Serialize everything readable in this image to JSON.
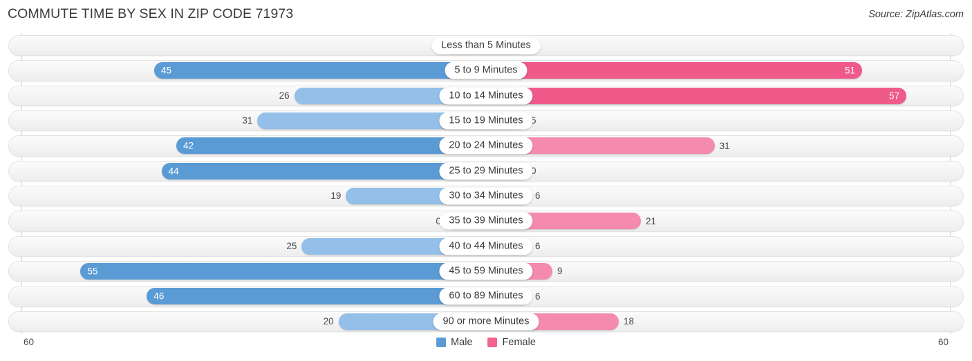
{
  "header": {
    "title": "COMMUTE TIME BY SEX IN ZIP CODE 71973",
    "source": "Source: ZipAtlas.com"
  },
  "legend": {
    "male_label": "Male",
    "female_label": "Female",
    "male_color": "#5b9bd5",
    "female_color": "#f2648f"
  },
  "axis": {
    "left_tick": "60",
    "right_tick": "60",
    "max": 60
  },
  "chart_data": {
    "type": "bar",
    "title": "COMMUTE TIME BY SEX IN ZIP CODE 71973",
    "subtitle": "Source: ZipAtlas.com",
    "orientation": "horizontal-diverging",
    "xlabel": "",
    "ylabel": "",
    "xlim": [
      60,
      60
    ],
    "grid": false,
    "legend_position": "bottom-center",
    "categories": [
      "Less than 5 Minutes",
      "5 to 9 Minutes",
      "10 to 14 Minutes",
      "15 to 19 Minutes",
      "20 to 24 Minutes",
      "25 to 29 Minutes",
      "30 to 34 Minutes",
      "35 to 39 Minutes",
      "40 to 44 Minutes",
      "45 to 59 Minutes",
      "60 to 89 Minutes",
      "90 or more Minutes"
    ],
    "series": [
      {
        "name": "Male",
        "color": "#5b9bd5",
        "values": [
          0,
          45,
          26,
          31,
          42,
          44,
          19,
          0,
          25,
          55,
          46,
          20
        ]
      },
      {
        "name": "Female",
        "color": "#f2648f",
        "values": [
          0,
          51,
          57,
          5,
          31,
          0,
          6,
          21,
          6,
          9,
          6,
          18
        ]
      }
    ]
  },
  "rows": [
    {
      "label": "Less than 5 Minutes",
      "male": "0",
      "female": "0",
      "male_val": 0,
      "female_val": 0
    },
    {
      "label": "5 to 9 Minutes",
      "male": "45",
      "female": "51",
      "male_val": 45,
      "female_val": 51
    },
    {
      "label": "10 to 14 Minutes",
      "male": "26",
      "female": "57",
      "male_val": 26,
      "female_val": 57
    },
    {
      "label": "15 to 19 Minutes",
      "male": "31",
      "female": "5",
      "male_val": 31,
      "female_val": 5
    },
    {
      "label": "20 to 24 Minutes",
      "male": "42",
      "female": "31",
      "male_val": 42,
      "female_val": 31
    },
    {
      "label": "25 to 29 Minutes",
      "male": "44",
      "female": "0",
      "male_val": 44,
      "female_val": 0
    },
    {
      "label": "30 to 34 Minutes",
      "male": "19",
      "female": "6",
      "male_val": 19,
      "female_val": 6
    },
    {
      "label": "35 to 39 Minutes",
      "male": "0",
      "female": "21",
      "male_val": 0,
      "female_val": 21
    },
    {
      "label": "40 to 44 Minutes",
      "male": "25",
      "female": "6",
      "male_val": 25,
      "female_val": 6
    },
    {
      "label": "45 to 59 Minutes",
      "male": "55",
      "female": "9",
      "male_val": 55,
      "female_val": 9
    },
    {
      "label": "60 to 89 Minutes",
      "male": "46",
      "female": "6",
      "male_val": 46,
      "female_val": 6
    },
    {
      "label": "90 or more Minutes",
      "male": "20",
      "female": "18",
      "male_val": 20,
      "female_val": 18
    }
  ]
}
